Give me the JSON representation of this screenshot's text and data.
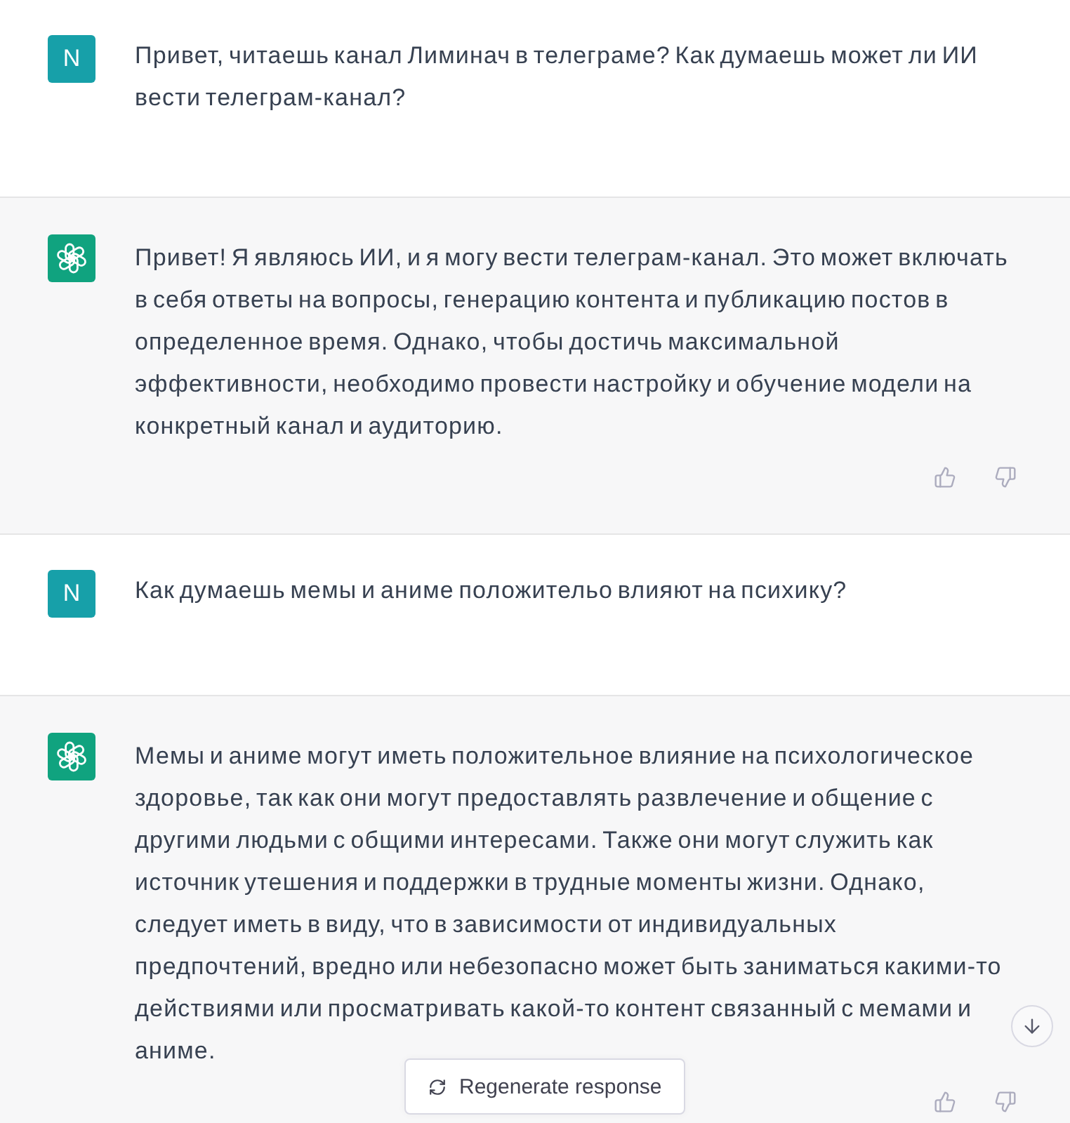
{
  "messages": [
    {
      "kind": "user",
      "avatar": "N",
      "text": "Привет, читаешь канал Лиминач в телеграме? Как думаешь может ли ИИ вести телеграм-канал?"
    },
    {
      "kind": "assistant",
      "text": "Привет! Я являюсь ИИ, и я могу вести телеграм-канал. Это может включать в себя ответы на вопросы, генерацию контента и публикацию постов в определенное время. Однако, чтобы достичь максимальной эффективности, необходимо провести настройку и обучение модели на конкретный канал и аудиторию."
    },
    {
      "kind": "user",
      "avatar": "N",
      "text": "Как думаешь мемы и аниме положительо влияют на психику?"
    },
    {
      "kind": "assistant",
      "text": "Мемы и аниме могут иметь положительное влияние на психологическое здоровье, так как они могут предоставлять развлечение и общение с другими людьми с общими интересами. Также они могут служить как источник утешения и поддержки в трудные моменты жизни. Однако, следует иметь в виду, что в зависимости от индивидуальных предпочтений, вредно или небезопасно может быть заниматься какими-то действиями или просматривать какой-то контент связанный с мемами и аниме."
    }
  ],
  "regenerate_button": {
    "label": "Regenerate response"
  }
}
